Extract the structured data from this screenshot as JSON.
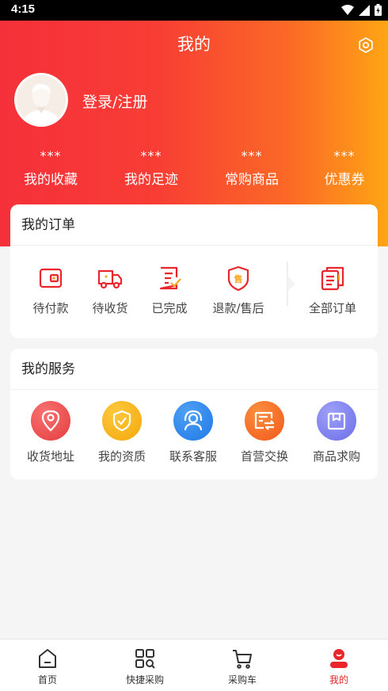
{
  "status": {
    "time": "4:15"
  },
  "header": {
    "title": "我的"
  },
  "profile": {
    "login_label": "登录/注册"
  },
  "stats": [
    {
      "value": "***",
      "label": "我的收藏"
    },
    {
      "value": "***",
      "label": "我的足迹"
    },
    {
      "value": "***",
      "label": "常购商品"
    },
    {
      "value": "***",
      "label": "优惠券"
    }
  ],
  "orders": {
    "title": "我的订单",
    "items": [
      {
        "label": "待付款",
        "icon": "wallet-icon"
      },
      {
        "label": "待收货",
        "icon": "truck-icon"
      },
      {
        "label": "已完成",
        "icon": "checklist-icon"
      },
      {
        "label": "退款/售后",
        "icon": "shield-after-sale-icon"
      },
      {
        "label": "全部订单",
        "icon": "all-orders-icon"
      }
    ],
    "after_sale_badge": "售"
  },
  "services": {
    "title": "我的服务",
    "items": [
      {
        "label": "收货地址",
        "icon": "location-pin-icon",
        "color": "#f04f4f"
      },
      {
        "label": "我的资质",
        "icon": "shield-check-icon",
        "color": "#f7b10f"
      },
      {
        "label": "联系客服",
        "icon": "customer-service-icon",
        "color": "#2d89f0"
      },
      {
        "label": "首营交换",
        "icon": "exchange-icon",
        "color": "#f56a20"
      },
      {
        "label": "商品求购",
        "icon": "box-icon",
        "color": "#7b80f2"
      }
    ]
  },
  "tabbar": {
    "items": [
      {
        "label": "首页",
        "icon": "home-icon"
      },
      {
        "label": "快捷采购",
        "icon": "qr-scan-icon"
      },
      {
        "label": "采购车",
        "icon": "cart-icon"
      },
      {
        "label": "我的",
        "icon": "profile-icon"
      }
    ],
    "active_index": 3,
    "active_color": "#e8262c"
  }
}
